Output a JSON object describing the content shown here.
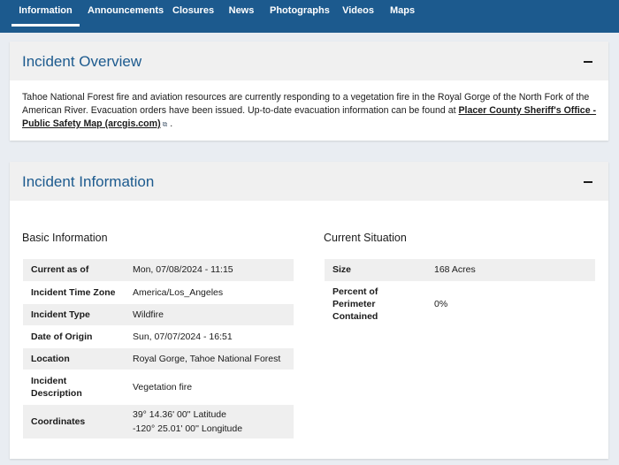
{
  "nav": {
    "tabs": [
      {
        "label": "Information",
        "active": true
      },
      {
        "label": "Announcements"
      },
      {
        "label": "Closures"
      },
      {
        "label": "News"
      },
      {
        "label": "Photographs"
      },
      {
        "label": "Videos"
      },
      {
        "label": "Maps"
      }
    ]
  },
  "overview": {
    "title": "Incident Overview",
    "text_before": "Tahoe National Forest fire and aviation resources are currently responding to a vegetation fire in the Royal Gorge of the North Fork of the American River. Evacuation orders have been issued. Up-to-date evacuation information can be found at ",
    "link": "Placer County Sheriff's Office - Public Safety Map (arcgis.com)",
    "text_after": " ."
  },
  "information": {
    "title": "Incident Information",
    "basic": {
      "heading": "Basic Information",
      "rows": [
        {
          "key": "Current as of",
          "value": "Mon, 07/08/2024 - 11:15"
        },
        {
          "key": "Incident Time Zone",
          "value": "America/Los_Angeles"
        },
        {
          "key": "Incident Type",
          "value": "Wildfire"
        },
        {
          "key": "Date of Origin",
          "value": "Sun, 07/07/2024 - 16:51"
        },
        {
          "key": "Location",
          "value": "Royal Gorge, Tahoe National Forest"
        },
        {
          "key": "Incident Description",
          "value": "Vegetation fire"
        },
        {
          "key": "Coordinates",
          "value": "39° 14.36' 00'' Latitude",
          "value2": "-120° 25.01' 00'' Longitude"
        }
      ]
    },
    "situation": {
      "heading": "Current Situation",
      "rows": [
        {
          "key": "Size",
          "value": "168 Acres"
        },
        {
          "key": "Percent of Perimeter Contained",
          "value": "0%"
        }
      ]
    }
  },
  "colors": {
    "nav": "#1c5a8e",
    "title": "#1c5a8e",
    "row_shade": "#efefef"
  }
}
